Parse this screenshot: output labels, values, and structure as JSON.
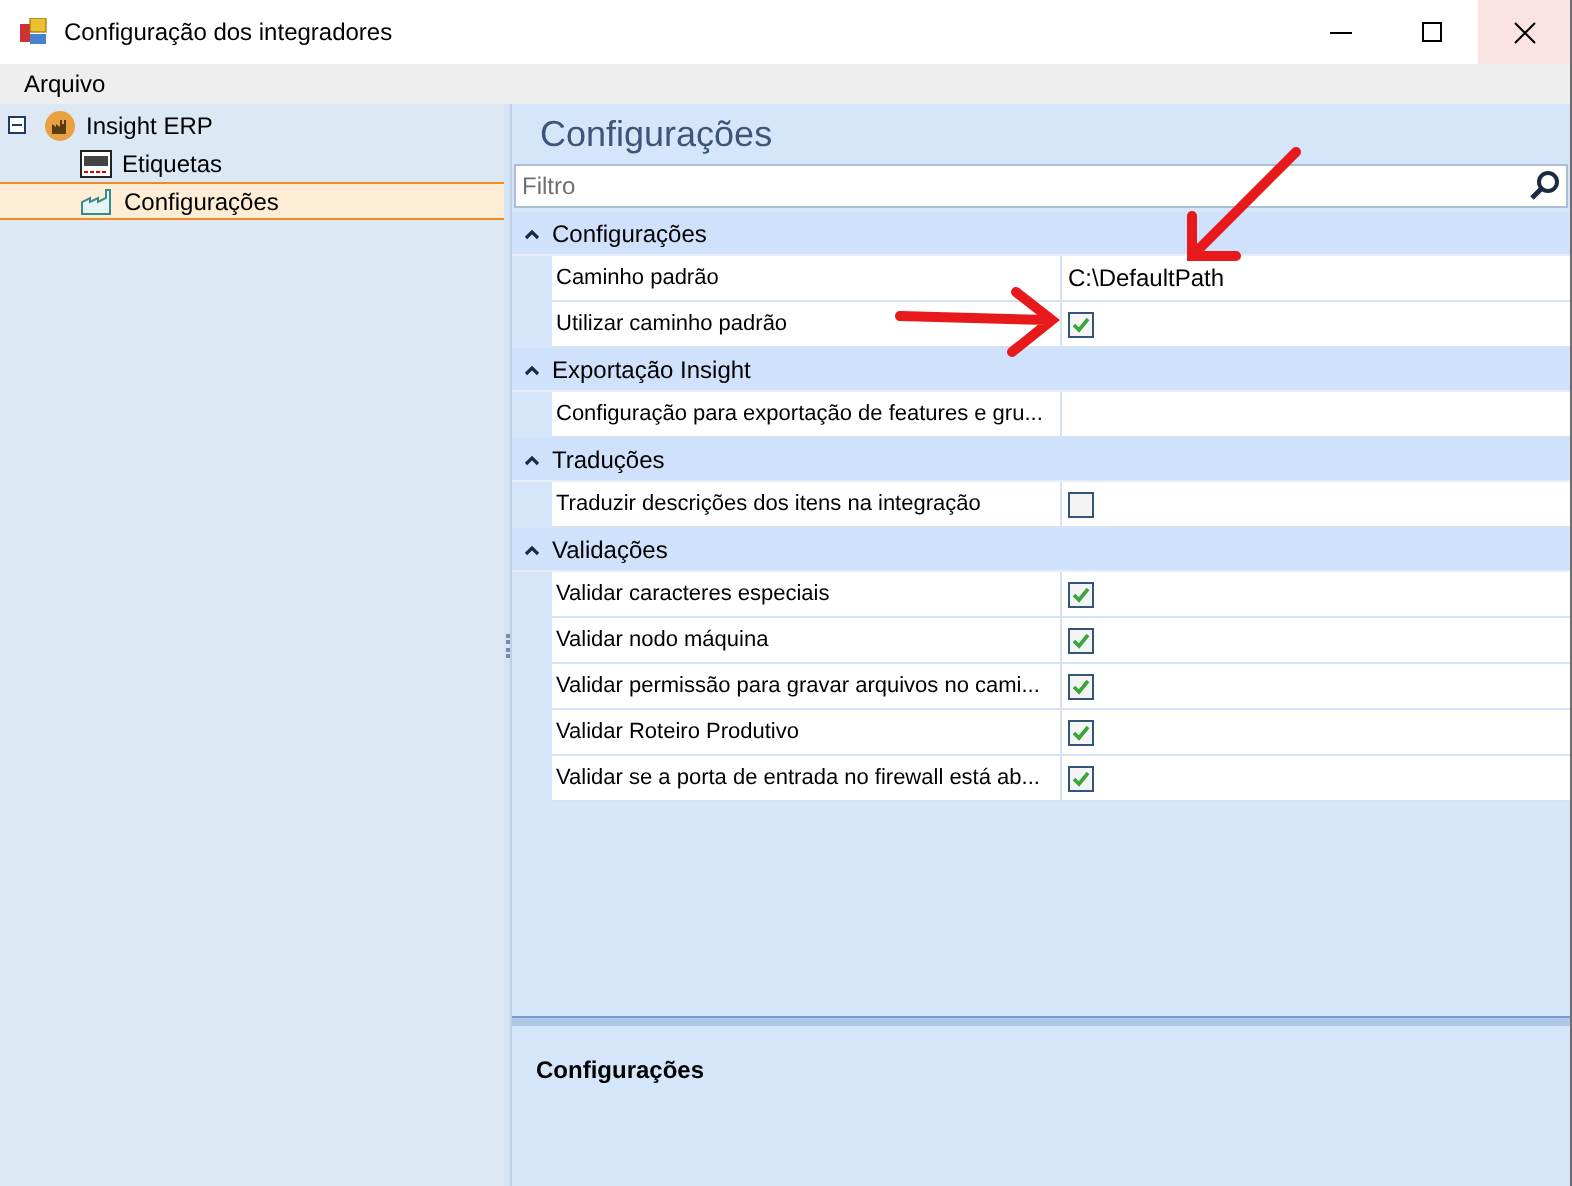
{
  "window": {
    "title": "Configuração dos integradores"
  },
  "menu": [
    "Arquivo"
  ],
  "tree": [
    {
      "label": "Insight ERP",
      "expanded": true,
      "selected": false,
      "kind": "factory",
      "children": [
        {
          "label": "Etiquetas",
          "selected": false,
          "kind": "label"
        },
        {
          "label": "Configurações",
          "selected": true,
          "kind": "config"
        }
      ]
    }
  ],
  "panel": {
    "title": "Configurações",
    "filter": {
      "placeholder": "Filtro"
    },
    "groups": [
      {
        "title": "Configurações",
        "expanded": true,
        "rows": [
          {
            "label": "Caminho padrão",
            "kind": "text",
            "value": "C:\\DefaultPath"
          },
          {
            "label": "Utilizar caminho padrão",
            "kind": "checkbox",
            "checked": true
          }
        ]
      },
      {
        "title": "Exportação Insight",
        "expanded": true,
        "rows": [
          {
            "label": "Configuração para exportação de features e gru...",
            "kind": "text"
          }
        ]
      },
      {
        "title": "Traduções",
        "expanded": true,
        "rows": [
          {
            "label": "Traduzir descrições dos itens na integração",
            "kind": "checkbox",
            "checked": false
          }
        ]
      },
      {
        "title": "Validações",
        "expanded": true,
        "rows": [
          {
            "label": "Validar caracteres especiais",
            "kind": "checkbox",
            "checked": true
          },
          {
            "label": "Validar nodo máquina",
            "kind": "checkbox",
            "checked": true
          },
          {
            "label": "Validar permissão para gravar arquivos no cami...",
            "kind": "checkbox",
            "checked": true
          },
          {
            "label": "Validar Roteiro Produtivo",
            "kind": "checkbox",
            "checked": true
          },
          {
            "label": "Validar se a porta de entrada no firewall está ab...",
            "kind": "checkbox",
            "checked": true
          }
        ]
      }
    ],
    "description": {
      "title": "Configurações"
    }
  }
}
